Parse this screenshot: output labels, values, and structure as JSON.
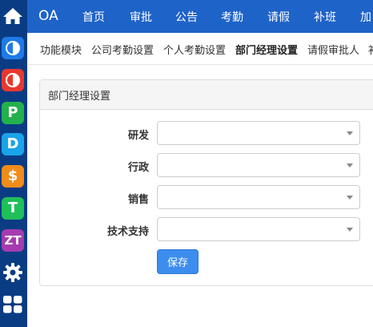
{
  "rail": {
    "items": [
      {
        "name": "home-icon",
        "color": "#0a3c84"
      },
      {
        "name": "app-c-icon",
        "glyph": "C",
        "color": "#1e7be6"
      },
      {
        "name": "app-o-icon",
        "glyph": "O",
        "color": "#e8382f"
      },
      {
        "name": "app-p-icon",
        "glyph": "P",
        "color": "#22b14c"
      },
      {
        "name": "app-d-icon",
        "glyph": "D",
        "color": "#1aa3e8"
      },
      {
        "name": "app-s-icon",
        "glyph": "$",
        "color": "#f08c1a"
      },
      {
        "name": "app-t-icon",
        "glyph": "T",
        "color": "#1fbf5a"
      },
      {
        "name": "app-zt-icon",
        "glyph": "ZT",
        "color": "#a63bb0"
      },
      {
        "name": "gear-icon",
        "color": "#0a3c84"
      },
      {
        "name": "apps-grid-icon",
        "color": "#0a3c84"
      }
    ]
  },
  "topnav": {
    "brand": "OA",
    "items": [
      "首页",
      "审批",
      "公告",
      "考勤",
      "请假",
      "补班",
      "加"
    ]
  },
  "subnav": {
    "items": [
      "功能模块",
      "公司考勤设置",
      "个人考勤设置",
      "部门经理设置",
      "请假审批人",
      "补"
    ],
    "active_index": 3
  },
  "panel": {
    "title": "部门经理设置",
    "fields": [
      {
        "label": "研发",
        "value": ""
      },
      {
        "label": "行政",
        "value": ""
      },
      {
        "label": "销售",
        "value": ""
      },
      {
        "label": "技术支持",
        "value": ""
      }
    ],
    "save_label": "保存"
  },
  "colors": {
    "topnav_bg": "#1e63c8",
    "rail_bg": "#0a3c84",
    "primary_button": "#3c8dee"
  }
}
